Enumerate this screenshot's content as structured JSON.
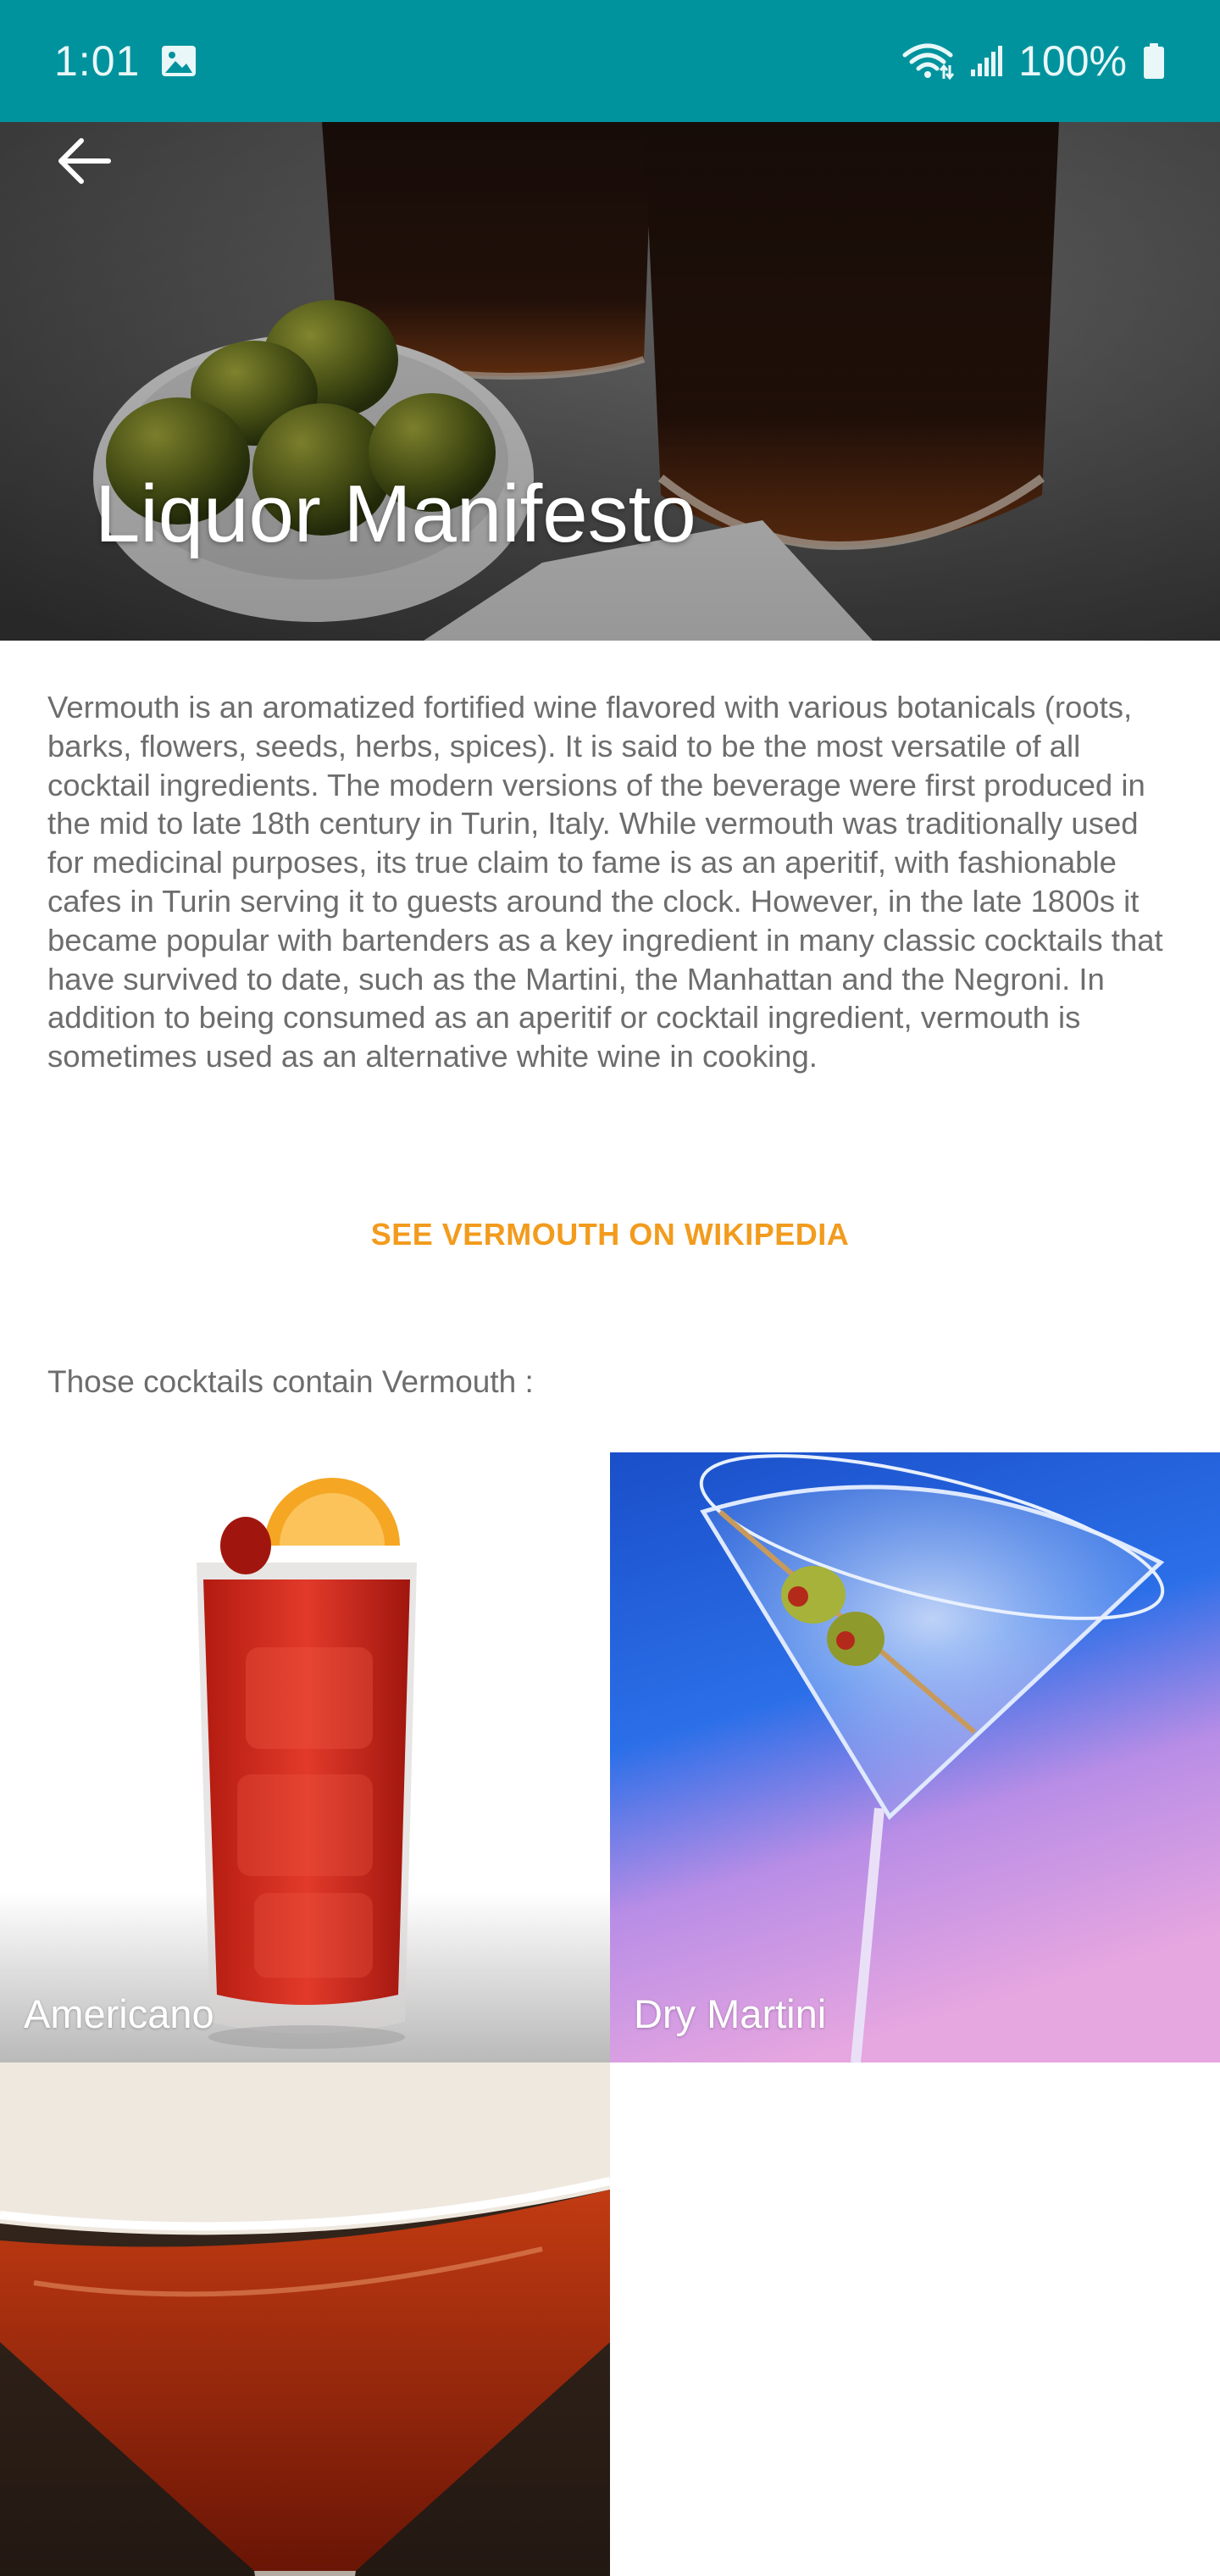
{
  "status_bar": {
    "time": "1:01",
    "battery": "100%",
    "icons": [
      "image-icon",
      "wifi-icon",
      "signal-icon",
      "battery-icon"
    ],
    "background": "#00939e"
  },
  "header": {
    "title": "Liquor Manifesto",
    "back_icon": "arrow-left-icon"
  },
  "article": {
    "description": "Vermouth is an aromatized fortified wine flavored with various botanicals (roots, barks, flowers, seeds, herbs, spices). It is said to be the most versatile of all cocktail ingredients. The modern versions of the beverage were first produced in the mid to late 18th century in Turin, Italy. While vermouth was traditionally used for medicinal purposes, its true claim to fame is as an aperitif, with fashionable cafes in Turin serving it to guests around the clock. However, in the late 1800s it became popular with bartenders as a key ingredient in many classic cocktails that have survived to date, such as the Martini, the Manhattan and the Negroni. In addition to being consumed as an aperitif or cocktail ingredient, vermouth is sometimes used as an alternative white wine in cooking.",
    "wiki_link": "SEE VERMOUTH ON WIKIPEDIA",
    "cocktails_heading": "Those cocktails contain Vermouth :"
  },
  "cocktails": [
    {
      "name": "Americano"
    },
    {
      "name": "Dry Martini"
    },
    {
      "name": ""
    }
  ],
  "colors": {
    "accent": "#f29b1d",
    "text_secondary": "#6d6d6d"
  }
}
